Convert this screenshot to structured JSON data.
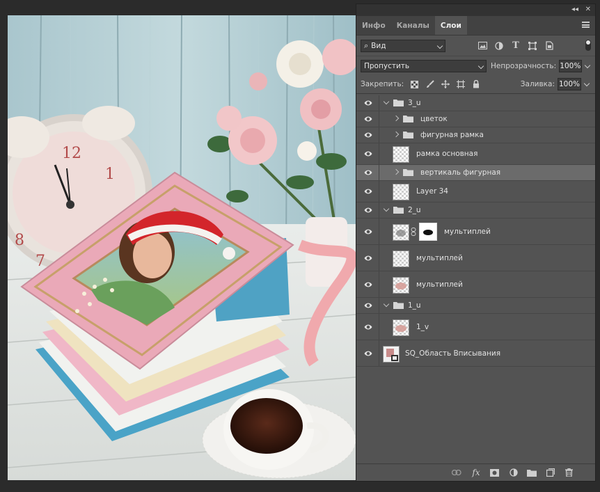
{
  "panel": {
    "collapse_label": "◂◂",
    "close_label": "✕",
    "tabs": [
      {
        "label": "Инфо"
      },
      {
        "label": "Каналы"
      },
      {
        "label": "Слои"
      }
    ],
    "active_tab": "Слои",
    "filter": {
      "kind_label": "Вид",
      "search_glyph": "⌕"
    },
    "blend_mode": "Пропустить",
    "opacity_label": "Непрозрачность:",
    "opacity_value": "100%",
    "lock_label": "Закрепить:",
    "fill_label": "Заливка:",
    "fill_value": "100%",
    "layers": [
      {
        "name": "3_u",
        "type": "group",
        "expanded": true,
        "visible": true
      },
      {
        "name": "цветок",
        "type": "group",
        "expanded": false,
        "visible": true
      },
      {
        "name": "фигурная рамка",
        "type": "group",
        "expanded": false,
        "visible": true
      },
      {
        "name": "рамка основная",
        "type": "layer",
        "visible": true
      },
      {
        "name": "вертикаль фигурная",
        "type": "group",
        "expanded": false,
        "visible": true,
        "selected": true
      },
      {
        "name": "Layer 34",
        "type": "layer",
        "visible": true
      },
      {
        "name": "2_u",
        "type": "group",
        "expanded": true,
        "visible": true
      },
      {
        "name": "мультиплей",
        "type": "masked-layer",
        "visible": true
      },
      {
        "name": "мультиплей",
        "type": "layer",
        "visible": true
      },
      {
        "name": "мультиплей",
        "type": "layer",
        "visible": true
      },
      {
        "name": "1_u",
        "type": "group",
        "expanded": true,
        "visible": true
      },
      {
        "name": "1_v",
        "type": "layer",
        "visible": true
      },
      {
        "name": "SQ_Область Вписывания",
        "type": "smart-object",
        "visible": true
      }
    ],
    "bottom_icons": [
      "link-icon",
      "fx-icon",
      "mask-icon",
      "adjustment-icon",
      "new-group-icon",
      "new-layer-icon",
      "trash-icon"
    ],
    "fx_label": "fx"
  },
  "colors": {
    "panel_bg": "#535353",
    "selected_row": "#6b6b6b",
    "canvas_bg": "#2b2b2b"
  }
}
